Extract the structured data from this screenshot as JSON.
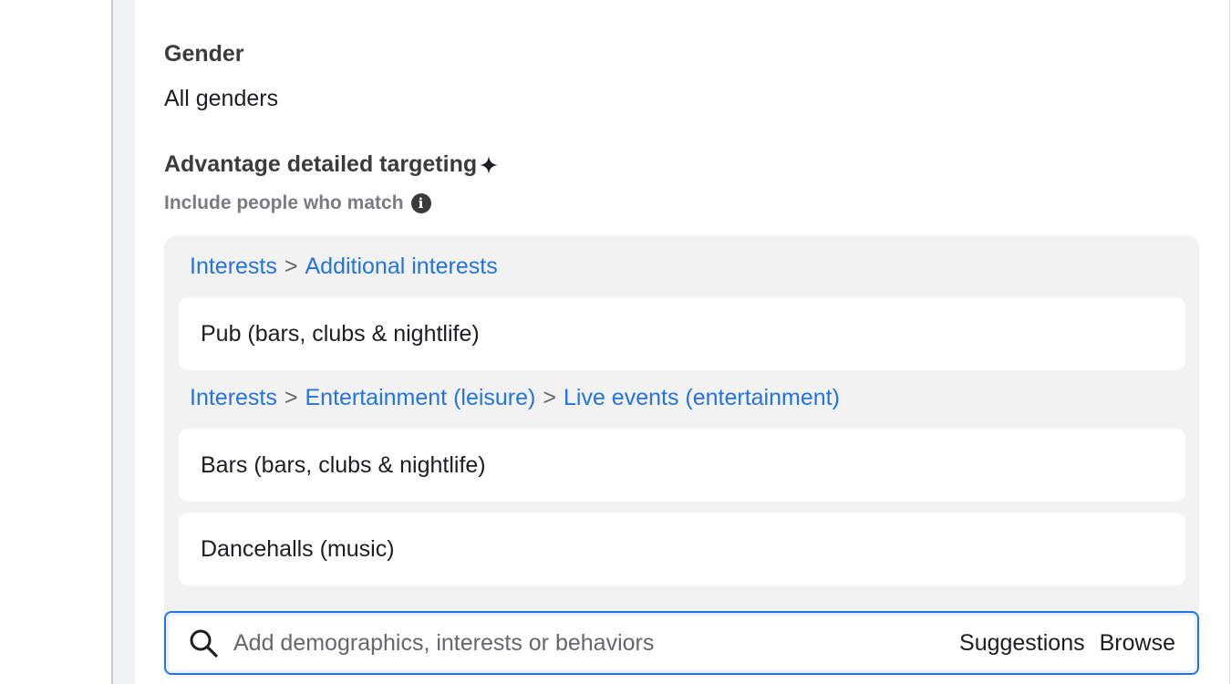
{
  "gender": {
    "label": "Gender",
    "value": "All genders"
  },
  "advantage": {
    "label": "Advantage detailed targeting",
    "sparkle_icon": "sparkle-icon",
    "include_label": "Include people who match",
    "info_icon": "info-icon"
  },
  "groups": [
    {
      "breadcrumb": [
        "Interests",
        "Additional interests"
      ],
      "items": [
        "Pub (bars, clubs & nightlife)"
      ]
    },
    {
      "breadcrumb": [
        "Interests",
        "Entertainment (leisure)",
        "Live events (entertainment)"
      ],
      "items": [
        "Bars (bars, clubs & nightlife)",
        "Dancehalls (music)"
      ]
    }
  ],
  "breadcrumb_separator": ">",
  "search": {
    "placeholder": "Add demographics, interests or behaviors",
    "suggestions_label": "Suggestions",
    "browse_label": "Browse"
  },
  "colors": {
    "link": "#2374e1",
    "focus_border": "#2374e1"
  }
}
